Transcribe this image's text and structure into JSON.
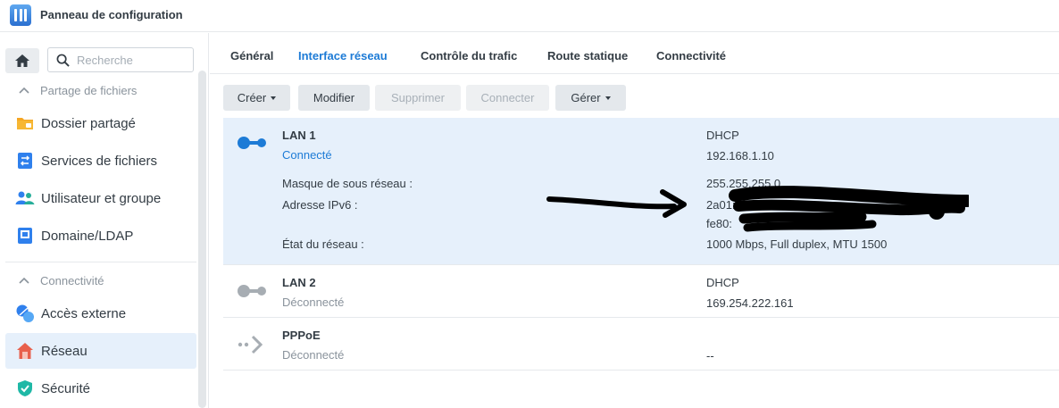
{
  "window": {
    "title": "Panneau de configuration",
    "icon": "control-panel-icon"
  },
  "sidebar": {
    "home_icon": "home-icon",
    "search_placeholder": "Recherche",
    "sections": [
      {
        "label": "Partage de fichiers",
        "expanded": true,
        "items": [
          {
            "label": "Dossier partagé",
            "icon": "shared-folder-icon"
          },
          {
            "label": "Services de fichiers",
            "icon": "file-services-icon"
          },
          {
            "label": "Utilisateur et groupe",
            "icon": "user-group-icon"
          },
          {
            "label": "Domaine/LDAP",
            "icon": "domain-ldap-icon"
          }
        ]
      },
      {
        "label": "Connectivité",
        "expanded": true,
        "items": [
          {
            "label": "Accès externe",
            "icon": "external-access-icon"
          },
          {
            "label": "Réseau",
            "icon": "network-house-icon",
            "active": true
          },
          {
            "label": "Sécurité",
            "icon": "security-shield-icon"
          }
        ]
      }
    ]
  },
  "tabs": [
    {
      "label": "Général"
    },
    {
      "label": "Interface réseau",
      "active": true
    },
    {
      "label": "Contrôle du trafic"
    },
    {
      "label": "Route statique"
    },
    {
      "label": "Connectivité"
    }
  ],
  "toolbar": {
    "create": "Créer",
    "modify": "Modifier",
    "delete": "Supprimer",
    "connect": "Connecter",
    "manage": "Gérer"
  },
  "interfaces": [
    {
      "name": "LAN 1",
      "status": "Connecté",
      "mode": "DHCP",
      "ip": "192.168.1.10",
      "details": {
        "subnet_label": "Masque de sous réseau :",
        "subnet": "255.255.255.0",
        "ipv6_label": "Adresse IPv6 :",
        "ipv6_line1": "2a01:",
        "ipv6_line2": "fe80:",
        "state_label": "État du réseau :",
        "state": "1000 Mbps, Full duplex, MTU 1500"
      }
    },
    {
      "name": "LAN 2",
      "status": "Déconnecté",
      "mode": "DHCP",
      "ip": "169.254.222.161"
    },
    {
      "name": "PPPoE",
      "status": "Déconnecté",
      "mode": "",
      "ip": "--"
    }
  ],
  "colors": {
    "accent": "#1d7bd6",
    "selected_row": "#e6f0fb",
    "muted": "#8a939c"
  }
}
